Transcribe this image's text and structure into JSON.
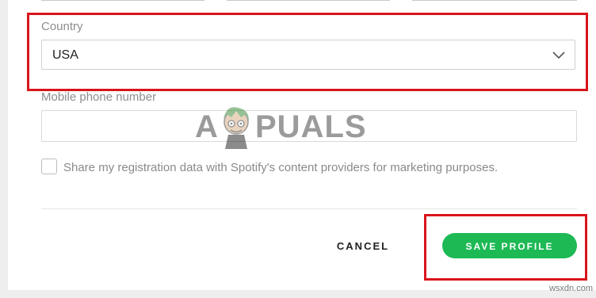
{
  "form": {
    "country": {
      "label": "Country",
      "selected": "USA"
    },
    "mobile_phone": {
      "label": "Mobile phone number",
      "value": "",
      "placeholder": ""
    },
    "marketing_consent": {
      "label": "Share my registration data with Spotify's content providers for marketing purposes.",
      "checked": false
    }
  },
  "actions": {
    "cancel_label": "CANCEL",
    "save_label": "SAVE PROFILE"
  },
  "watermark": {
    "text_left": "A",
    "text_right": "PUALS"
  },
  "source_mark": "wsxdn.com",
  "colors": {
    "accent": "#1db954",
    "highlight": "#d9141c"
  }
}
